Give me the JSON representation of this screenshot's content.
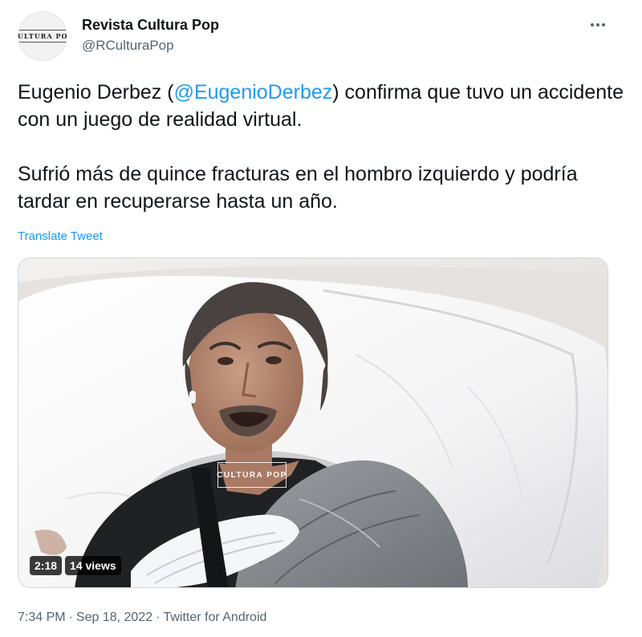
{
  "author": {
    "display_name": "Revista Cultura Pop",
    "handle": "@RCulturaPop",
    "avatar_text": "CULTURA POP"
  },
  "tweet": {
    "p1_before": "Eugenio Derbez (",
    "mention": "@EugenioDerbez",
    "p1_after": ") confirma que tuvo un accidente con un juego de realidad virtual.",
    "p2": "Sufrió más de quince fracturas en el hombro izquierdo y podría tardar en recuperarse hasta un año.",
    "translate_label": "Translate Tweet"
  },
  "media": {
    "watermark_text": "CULTURA POP",
    "duration": "2:18",
    "views": "14 views"
  },
  "meta": {
    "time": "7:34 PM",
    "date": "Sep 18, 2022",
    "source": "Twitter for Android",
    "separator": "·"
  },
  "icons": {
    "more": "more-horizontal-icon"
  }
}
